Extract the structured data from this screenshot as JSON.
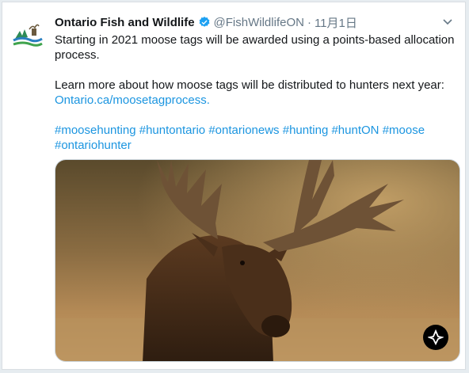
{
  "tweet": {
    "author_name": "Ontario Fish and Wildlife",
    "handle": "@FishWildlifeON",
    "separator": "·",
    "timestamp": "11月1日",
    "text_line1": "Starting in 2021 moose tags will be awarded using a points-based allocation process.",
    "text_line2": "Learn more about how moose tags will be distributed to hunters next year:",
    "link": "Ontario.ca/moosetagprocess.",
    "hashtags": [
      "#moosehunting",
      "#huntontario",
      "#ontarionews",
      "#hunting",
      "#huntON",
      "#moose",
      "#ontariohunter"
    ]
  },
  "colors": {
    "link": "#1b95e0",
    "verified": "#1da1f2",
    "text": "#14171a",
    "muted": "#657786"
  },
  "icons": {
    "avatar": "ontario-fish-wildlife-logo",
    "verified": "verified-badge-icon",
    "caret": "chevron-down-icon",
    "media_badge": "ontario-trillium-icon"
  }
}
